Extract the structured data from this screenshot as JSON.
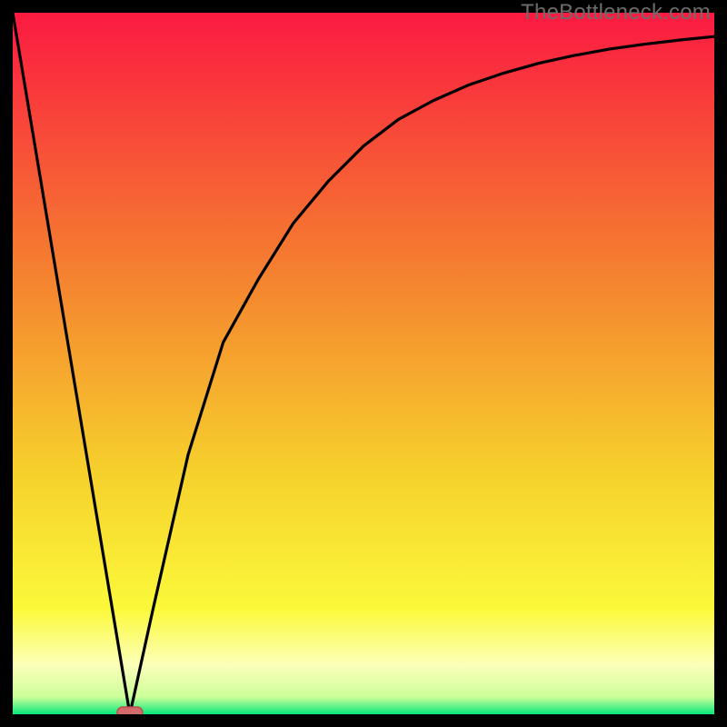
{
  "watermark": "TheBottleneck.com",
  "colors": {
    "frame": "#000000",
    "gradient_top": "#fb1a41",
    "gradient_mid1": "#f57b30",
    "gradient_mid2": "#f6cf2c",
    "gradient_mid3": "#fbf93a",
    "gradient_band": "#fcffba",
    "gradient_green": "#09e87b",
    "curve": "#000000",
    "marker_fill": "#d36a6b",
    "marker_stroke": "#bb4e50"
  },
  "chart_data": {
    "type": "line",
    "title": "",
    "xlabel": "",
    "ylabel": "",
    "xlim": [
      0,
      100
    ],
    "ylim": [
      0,
      100
    ],
    "series": [
      {
        "name": "bottleneck-curve",
        "x": [
          0,
          16.7,
          20,
          25,
          30,
          35,
          40,
          45,
          50,
          55,
          60,
          65,
          70,
          75,
          80,
          85,
          90,
          95,
          100
        ],
        "y": [
          100,
          0,
          15,
          37,
          53,
          62,
          70,
          76,
          81,
          84.8,
          87.5,
          89.7,
          91.4,
          92.8,
          93.9,
          94.8,
          95.5,
          96.1,
          96.6
        ]
      }
    ],
    "marker": {
      "x": 16.7,
      "y": 0
    },
    "gradient_stops": [
      {
        "pct": 0,
        "color": "#fb1a41"
      },
      {
        "pct": 35,
        "color": "#f57b30"
      },
      {
        "pct": 65,
        "color": "#f6cf2c"
      },
      {
        "pct": 85,
        "color": "#fbf93a"
      },
      {
        "pct": 93,
        "color": "#fcffba"
      },
      {
        "pct": 97.5,
        "color": "#ccff9a"
      },
      {
        "pct": 100,
        "color": "#09e87b"
      }
    ]
  }
}
